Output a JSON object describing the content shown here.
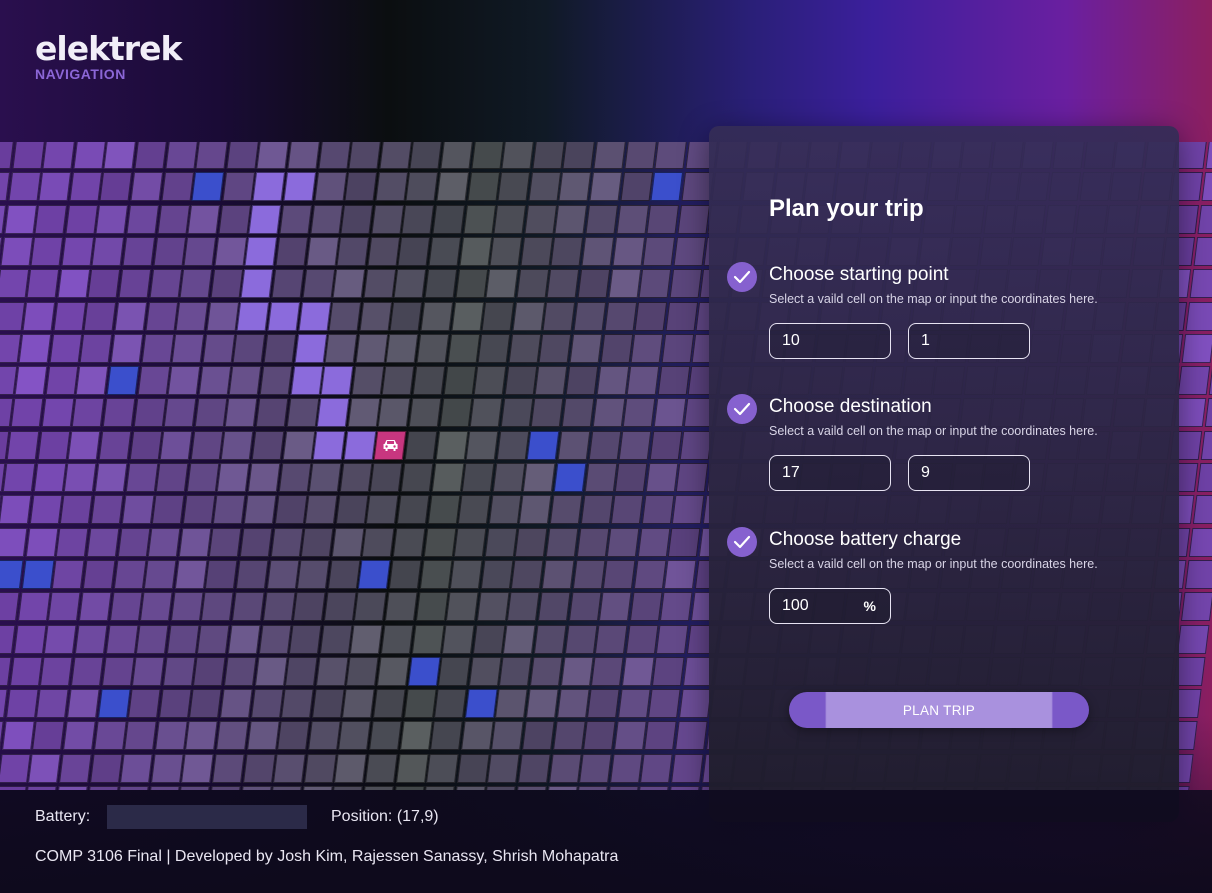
{
  "app": {
    "logo": "elektrek",
    "subtitle": "NAVIGATION"
  },
  "panel": {
    "title": "Plan your trip",
    "start": {
      "title": "Choose starting point",
      "desc": "Select a vaild cell on the map or input the coordinates here.",
      "x": "10",
      "y": "1"
    },
    "destination": {
      "title": "Choose destination",
      "desc": "Select a vaild cell on the map or input the coordinates here.",
      "x": "17",
      "y": "9"
    },
    "battery": {
      "title": "Choose battery charge",
      "desc": "Select a vaild cell on the map or input the coordinates here.",
      "value": "100",
      "unit": "%"
    },
    "button": "PLAN TRIP"
  },
  "footer": {
    "battery_label": "Battery:",
    "battery_level": 0,
    "position_label": "Position: (17,9)",
    "credits": "COMP 3106 Final | Developed by Josh Kim, Rajessen Sanassy, Shrish Mohapatra"
  },
  "map": {
    "car_icon": "car-icon",
    "path_color": "#8b6bdc",
    "station_color": "#3b4fcc",
    "car_color": "#c8367f"
  }
}
